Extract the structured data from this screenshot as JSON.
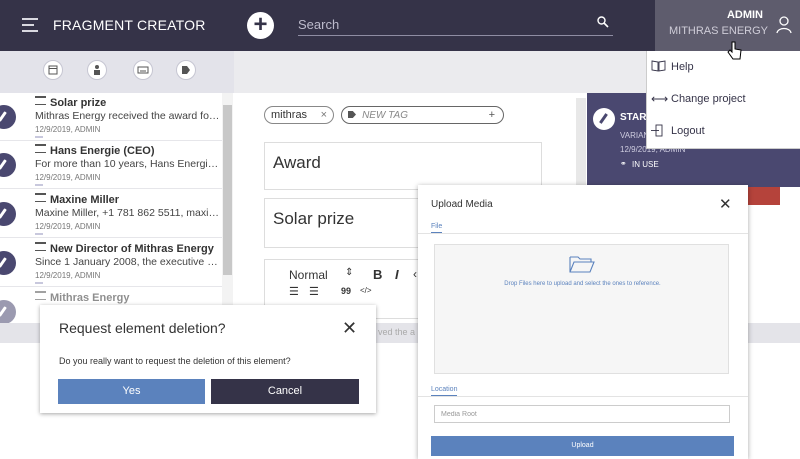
{
  "header": {
    "app_title": "FRAGMENT CREATOR",
    "search_placeholder": "Search",
    "user_name": "ADMIN",
    "user_company": "MITHRAS ENERGY"
  },
  "user_menu": {
    "items": [
      {
        "icon": "book-icon",
        "label": "Help"
      },
      {
        "icon": "swap-arrows-icon",
        "label": "Change project"
      },
      {
        "icon": "logout-icon",
        "label": "Logout"
      }
    ]
  },
  "filters": [
    "calendar-icon",
    "person-icon",
    "keyboard-icon",
    "tag-icon"
  ],
  "list": {
    "items": [
      {
        "title": "Solar prize",
        "desc": "Mithras Energy received the award for its...",
        "meta": "12/9/2019, ADMIN"
      },
      {
        "title": "Hans Energie (CEO)",
        "desc": "For more than 10 years, Hans Energie h...",
        "meta": "12/9/2019, ADMIN"
      },
      {
        "title": "Maxine Miller",
        "desc": "Maxine Miller, +1 781 862 5511, maxine...",
        "meta": "12/9/2019, ADMIN"
      },
      {
        "title": "New Director of Mithras Energy",
        "desc": "Since 1 January 2008, the executive man...",
        "meta": "12/9/2019, ADMIN"
      },
      {
        "title": "Mithras Energy",
        "desc": "",
        "meta": ""
      }
    ]
  },
  "editor": {
    "tag": "mithras",
    "new_tag_placeholder": "NEW TAG",
    "category_value": "Award",
    "title_value": "Solar prize",
    "format_select": "Normal",
    "bold": "B",
    "italic": "I",
    "quote": "99",
    "code": "</>",
    "partial_text": "ved the a"
  },
  "card": {
    "title": "START",
    "variant": "VARIAN",
    "meta": "12/9/2019, ADMIN",
    "status": "IN USE"
  },
  "delete_dialog": {
    "title": "Request element deletion?",
    "message": "Do you really want to request the deletion of this element?",
    "yes_label": "Yes",
    "cancel_label": "Cancel"
  },
  "upload_dialog": {
    "title": "Upload Media",
    "file_tab": "File",
    "drop_text": "Drop Files here to upload and select the ones to reference.",
    "location_tab": "Location",
    "location_value": "Media Root",
    "upload_label": "Upload"
  },
  "colors": {
    "topbar": "#353348",
    "accent": "#5b82bd",
    "danger": "#b5433b",
    "pen": "#4a4870"
  }
}
